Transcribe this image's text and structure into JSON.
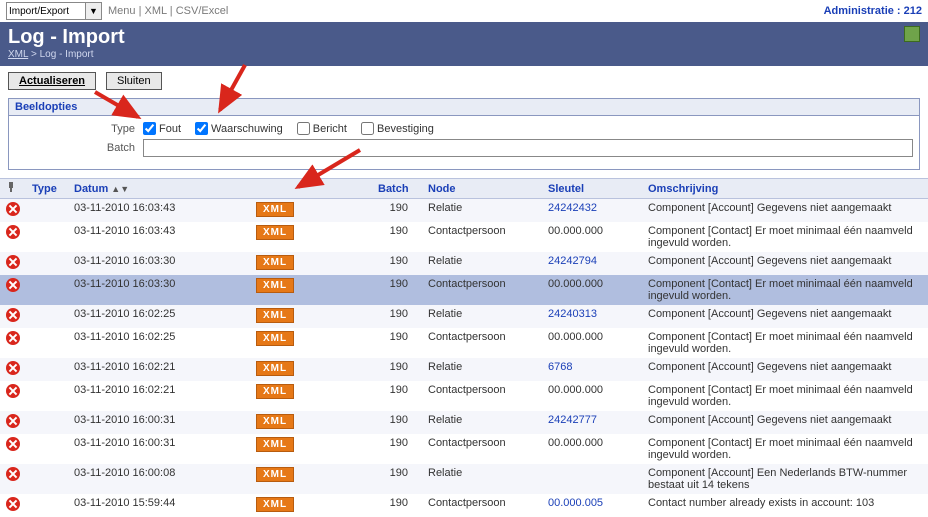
{
  "topbar": {
    "combo_value": "Import/Export",
    "menu": "Menu",
    "xml": "XML",
    "csv": "CSV/Excel",
    "admin": "Administratie : 212"
  },
  "header": {
    "title": "Log - Import",
    "bc_root": "XML",
    "bc_sep": " > ",
    "bc_cur": "Log - Import"
  },
  "buttons": {
    "refresh": "Actualiseren",
    "close": "Sluiten"
  },
  "filter": {
    "legend": "Beeldopties",
    "type_label": "Type",
    "fout": "Fout",
    "waarsch": "Waarschuwing",
    "bericht": "Bericht",
    "bevest": "Bevestiging",
    "batch_label": "Batch"
  },
  "cols": {
    "type": "Type",
    "datum": "Datum",
    "batch": "Batch",
    "node": "Node",
    "sleutel": "Sleutel",
    "omschr": "Omschrijving"
  },
  "badge": "XML",
  "rows": [
    {
      "d": "03-11-2010 16:03:43",
      "b": "190",
      "n": "Relatie",
      "k": "24242432",
      "klink": true,
      "o": "Component [Account] Gegevens niet aangemaakt",
      "sel": false
    },
    {
      "d": "03-11-2010 16:03:43",
      "b": "190",
      "n": "Contactpersoon",
      "k": "00.000.000",
      "klink": false,
      "o": "Component [Contact] Er moet minimaal één naamveld ingevuld worden.",
      "sel": false
    },
    {
      "d": "03-11-2010 16:03:30",
      "b": "190",
      "n": "Relatie",
      "k": "24242794",
      "klink": true,
      "o": "Component [Account] Gegevens niet aangemaakt",
      "sel": false
    },
    {
      "d": "03-11-2010 16:03:30",
      "b": "190",
      "n": "Contactpersoon",
      "k": "00.000.000",
      "klink": false,
      "o": "Component [Contact] Er moet minimaal één naamveld ingevuld worden.",
      "sel": true
    },
    {
      "d": "03-11-2010 16:02:25",
      "b": "190",
      "n": "Relatie",
      "k": "24240313",
      "klink": true,
      "o": "Component [Account] Gegevens niet aangemaakt",
      "sel": false
    },
    {
      "d": "03-11-2010 16:02:25",
      "b": "190",
      "n": "Contactpersoon",
      "k": "00.000.000",
      "klink": false,
      "o": "Component [Contact] Er moet minimaal één naamveld ingevuld worden.",
      "sel": false
    },
    {
      "d": "03-11-2010 16:02:21",
      "b": "190",
      "n": "Relatie",
      "k": "6768",
      "klink": true,
      "o": "Component [Account] Gegevens niet aangemaakt",
      "sel": false
    },
    {
      "d": "03-11-2010 16:02:21",
      "b": "190",
      "n": "Contactpersoon",
      "k": "00.000.000",
      "klink": false,
      "o": "Component [Contact] Er moet minimaal één naamveld ingevuld worden.",
      "sel": false
    },
    {
      "d": "03-11-2010 16:00:31",
      "b": "190",
      "n": "Relatie",
      "k": "24242777",
      "klink": true,
      "o": "Component [Account] Gegevens niet aangemaakt",
      "sel": false
    },
    {
      "d": "03-11-2010 16:00:31",
      "b": "190",
      "n": "Contactpersoon",
      "k": "00.000.000",
      "klink": false,
      "o": "Component [Contact] Er moet minimaal één naamveld ingevuld worden.",
      "sel": false
    },
    {
      "d": "03-11-2010 16:00:08",
      "b": "190",
      "n": "Relatie",
      "k": "",
      "klink": false,
      "o": "Component [Account] Een Nederlands BTW-nummer bestaat uit 14 tekens",
      "sel": false
    },
    {
      "d": "03-11-2010 15:59:44",
      "b": "190",
      "n": "Contactpersoon",
      "k": "00.000.005",
      "klink": true,
      "o": "Contact number already exists in account: 103",
      "sel": false
    }
  ]
}
